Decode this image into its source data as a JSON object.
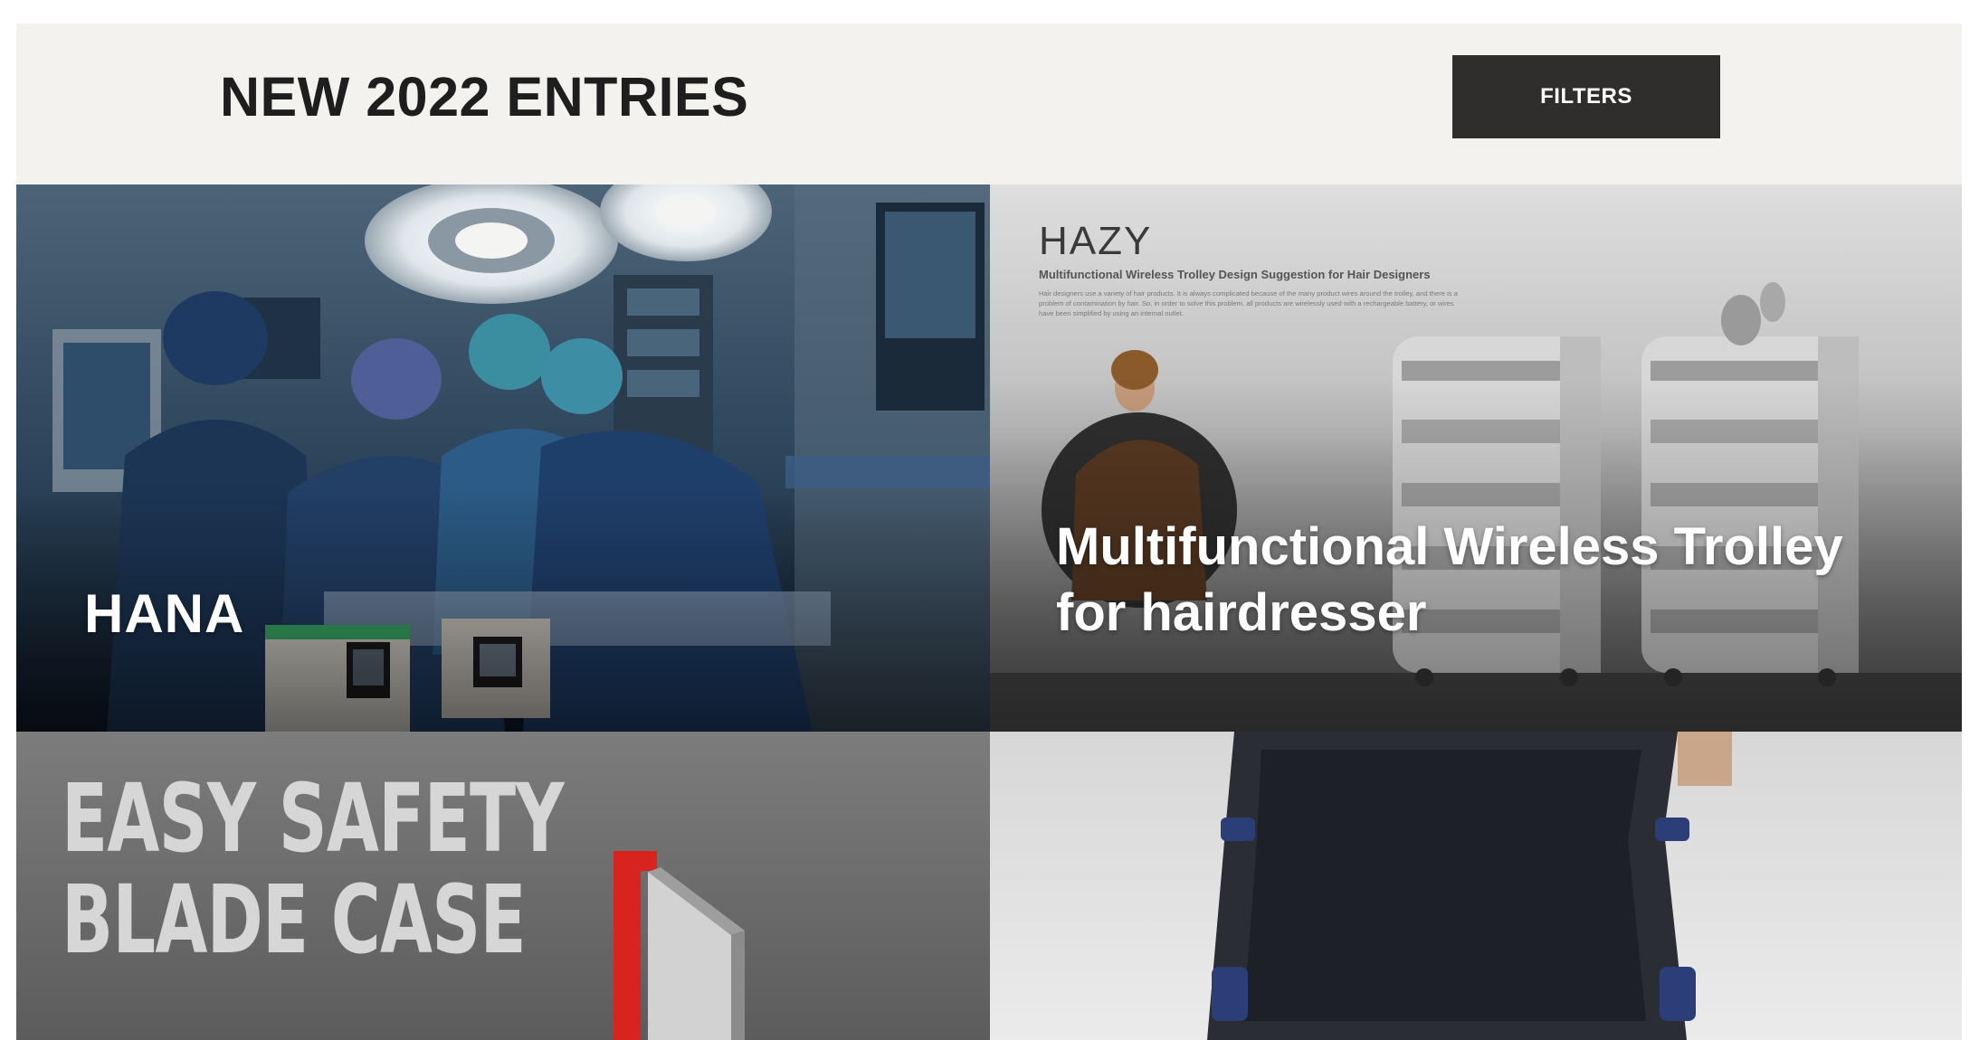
{
  "header": {
    "title": "NEW 2022 ENTRIES",
    "filters_label": "FILTERS"
  },
  "tiles": [
    {
      "title": "HANA",
      "image": "operating-room-photo"
    },
    {
      "title": "Multifunctional Wireless Trolley for hairdresser",
      "image": "hair-trolley-poster",
      "poster": {
        "logo": "HAZY",
        "subtitle": "Multifunctional Wireless Trolley Design Suggestion for Hair Designers",
        "description": "Hair designers use a variety of hair products. It is always complicated because of the many product wires around the trolley, and there is a problem of contamination by hair. So, in order to solve this problem, all products are wirelessly used with a rechargeable battery, or wires have been simplified by using an internal outlet."
      }
    },
    {
      "title_line1": "EASY SAFETY",
      "title_line2": "BLADE CASE",
      "image": "blade-case-render"
    },
    {
      "image": "wearable-vest-photo"
    }
  ],
  "colors": {
    "header_bg": "#f3f2ef",
    "button_bg": "#2f2e2d",
    "title_text": "#1e1e1e",
    "tile_text": "#ffffff",
    "blade_red": "#d9231f"
  }
}
